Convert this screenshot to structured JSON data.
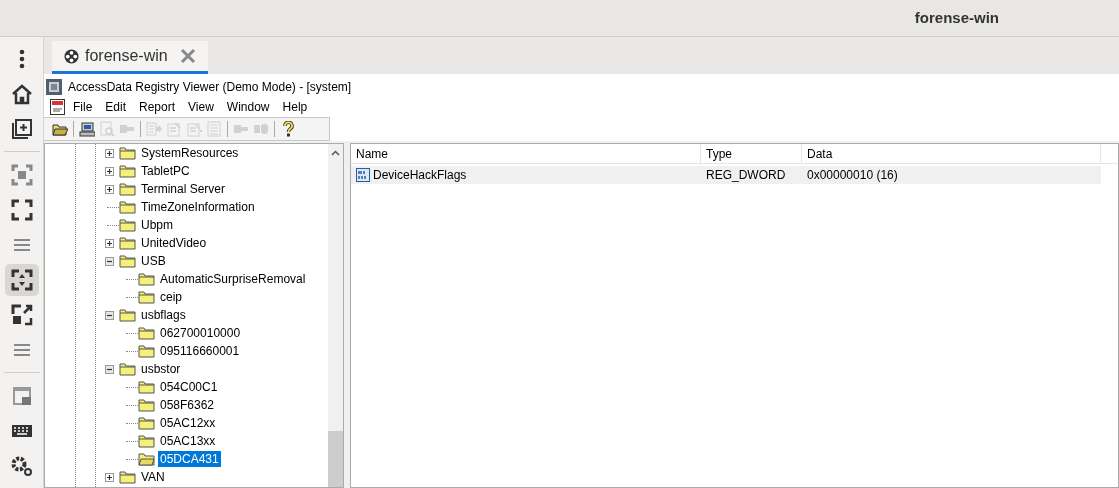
{
  "window": {
    "title": "forense-win"
  },
  "sidebar": {
    "items": [
      {
        "kind": "menu",
        "selected": false
      },
      {
        "kind": "home",
        "selected": false
      },
      {
        "kind": "new-window",
        "selected": false
      },
      {
        "kind": "focus",
        "selected": false
      },
      {
        "kind": "fullscreen",
        "selected": false
      },
      {
        "kind": "lines",
        "selected": false
      },
      {
        "kind": "fit",
        "selected": true
      },
      {
        "kind": "expand",
        "selected": false
      },
      {
        "kind": "lines",
        "selected": false
      },
      {
        "kind": "window",
        "selected": false
      },
      {
        "kind": "keyboard",
        "selected": false
      },
      {
        "kind": "settings",
        "selected": false
      }
    ]
  },
  "tabs": [
    {
      "label": "forense-win",
      "selected": true
    }
  ],
  "app": {
    "title": "AccessData Registry Viewer (Demo Mode) - [system]",
    "menu": [
      "File",
      "Edit",
      "Report",
      "View",
      "Window",
      "Help"
    ],
    "toolbar": [
      {
        "kind": "open",
        "disabled": false
      },
      {
        "kind": "computer",
        "disabled": false
      },
      {
        "kind": "find",
        "disabled": true
      },
      {
        "kind": "key",
        "disabled": true
      },
      {
        "kind": "export",
        "disabled": true
      },
      {
        "kind": "report",
        "disabled": true
      },
      {
        "kind": "report-add",
        "disabled": true
      },
      {
        "kind": "list",
        "disabled": true
      },
      {
        "kind": "key",
        "disabled": true
      },
      {
        "kind": "keys",
        "disabled": true
      },
      {
        "kind": "help",
        "disabled": false
      }
    ],
    "tree": [
      {
        "label": "SystemResources",
        "expanded": false,
        "selected": false
      },
      {
        "label": "TabletPC",
        "expanded": false,
        "selected": false
      },
      {
        "label": "Terminal Server",
        "expanded": false,
        "selected": false
      },
      {
        "label": "TimeZoneInformation",
        "selected": false
      },
      {
        "label": "Ubpm",
        "selected": false
      },
      {
        "label": "UnitedVideo",
        "expanded": false,
        "selected": false
      },
      {
        "label": "USB",
        "expanded": true,
        "selected": false,
        "children": [
          {
            "label": "AutomaticSurpriseRemoval",
            "selected": false
          },
          {
            "label": "ceip",
            "selected": false
          }
        ]
      },
      {
        "label": "usbflags",
        "expanded": true,
        "selected": false,
        "children": [
          {
            "label": "062700010000",
            "selected": false
          },
          {
            "label": "095116660001",
            "selected": false
          }
        ]
      },
      {
        "label": "usbstor",
        "expanded": true,
        "selected": false,
        "children": [
          {
            "label": "054C00C1",
            "selected": false
          },
          {
            "label": "058F6362",
            "selected": false
          },
          {
            "label": "05AC12xx",
            "selected": false
          },
          {
            "label": "05AC13xx",
            "selected": false
          },
          {
            "label": "05DCA431",
            "selected": true
          }
        ]
      },
      {
        "label": "VAN",
        "expanded": false,
        "selected": false
      }
    ],
    "table": {
      "columns": [
        "Name",
        "Type",
        "Data"
      ],
      "rows": [
        {
          "cells": [
            "DeviceHackFlags",
            "REG_DWORD",
            "0x00000010 (16)"
          ],
          "selected": true
        }
      ]
    }
  }
}
